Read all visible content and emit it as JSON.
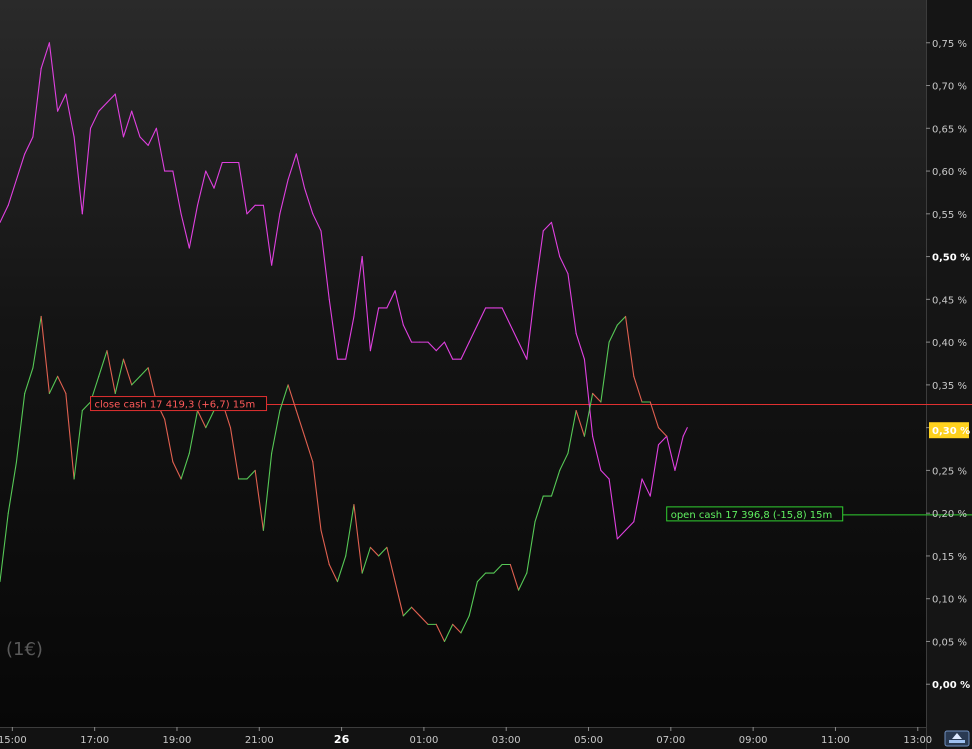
{
  "watermark": "(1€)",
  "chart_data": {
    "type": "line",
    "y_unit": "%",
    "ylim": [
      -0.05,
      0.8
    ],
    "y_ticks": [
      "0,75 %",
      "0,70 %",
      "0,65 %",
      "0,60 %",
      "0,55 %",
      "0,50 %",
      "0,45 %",
      "0,40 %",
      "0,35 %",
      "0,30 %",
      "0,25 %",
      "0,20 %",
      "0,15 %",
      "0,10 %",
      "0,05 %",
      "0,00 %"
    ],
    "y_tick_values": [
      0.75,
      0.7,
      0.65,
      0.6,
      0.55,
      0.5,
      0.45,
      0.4,
      0.35,
      0.3,
      0.25,
      0.2,
      0.15,
      0.1,
      0.05,
      0.0
    ],
    "bold_ticks": [
      "0,50 %",
      "0,00 %"
    ],
    "x_ticks": [
      {
        "label": "15:00",
        "t": 0
      },
      {
        "label": "17:00",
        "t": 2
      },
      {
        "label": "19:00",
        "t": 4
      },
      {
        "label": "21:00",
        "t": 6
      },
      {
        "label": "26",
        "t": 8,
        "bold": true
      },
      {
        "label": "01:00",
        "t": 10
      },
      {
        "label": "03:00",
        "t": 12
      },
      {
        "label": "05:00",
        "t": 14
      },
      {
        "label": "07:00",
        "t": 16
      },
      {
        "label": "09:00",
        "t": 18
      },
      {
        "label": "11:00",
        "t": 20
      },
      {
        "label": "13:00",
        "t": 22
      }
    ],
    "xlim": [
      -0.3,
      22.2
    ],
    "series": [
      {
        "color": "#e040e0",
        "points": [
          [
            -0.3,
            0.54
          ],
          [
            -0.1,
            0.56
          ],
          [
            0.1,
            0.59
          ],
          [
            0.3,
            0.62
          ],
          [
            0.5,
            0.64
          ],
          [
            0.7,
            0.72
          ],
          [
            0.9,
            0.75
          ],
          [
            1.1,
            0.67
          ],
          [
            1.3,
            0.69
          ],
          [
            1.5,
            0.64
          ],
          [
            1.7,
            0.55
          ],
          [
            1.9,
            0.65
          ],
          [
            2.1,
            0.67
          ],
          [
            2.3,
            0.68
          ],
          [
            2.5,
            0.69
          ],
          [
            2.7,
            0.64
          ],
          [
            2.9,
            0.67
          ],
          [
            3.1,
            0.64
          ],
          [
            3.3,
            0.63
          ],
          [
            3.5,
            0.65
          ],
          [
            3.7,
            0.6
          ],
          [
            3.9,
            0.6
          ],
          [
            4.1,
            0.55
          ],
          [
            4.3,
            0.51
          ],
          [
            4.5,
            0.56
          ],
          [
            4.7,
            0.6
          ],
          [
            4.9,
            0.58
          ],
          [
            5.1,
            0.61
          ],
          [
            5.3,
            0.61
          ],
          [
            5.5,
            0.61
          ],
          [
            5.7,
            0.55
          ],
          [
            5.9,
            0.56
          ],
          [
            6.1,
            0.56
          ],
          [
            6.3,
            0.49
          ],
          [
            6.5,
            0.55
          ],
          [
            6.7,
            0.59
          ],
          [
            6.9,
            0.62
          ],
          [
            7.1,
            0.58
          ],
          [
            7.3,
            0.55
          ],
          [
            7.5,
            0.53
          ],
          [
            7.7,
            0.45
          ],
          [
            7.9,
            0.38
          ],
          [
            8.1,
            0.38
          ],
          [
            8.3,
            0.43
          ],
          [
            8.5,
            0.5
          ],
          [
            8.7,
            0.39
          ],
          [
            8.9,
            0.44
          ],
          [
            9.1,
            0.44
          ],
          [
            9.3,
            0.46
          ],
          [
            9.5,
            0.42
          ],
          [
            9.7,
            0.4
          ],
          [
            9.9,
            0.4
          ],
          [
            10.1,
            0.4
          ],
          [
            10.3,
            0.39
          ],
          [
            10.5,
            0.4
          ],
          [
            10.7,
            0.38
          ],
          [
            10.9,
            0.38
          ],
          [
            11.1,
            0.4
          ],
          [
            11.3,
            0.42
          ],
          [
            11.5,
            0.44
          ],
          [
            11.7,
            0.44
          ],
          [
            11.9,
            0.44
          ],
          [
            12.1,
            0.42
          ],
          [
            12.3,
            0.4
          ],
          [
            12.5,
            0.38
          ],
          [
            12.7,
            0.46
          ],
          [
            12.9,
            0.53
          ],
          [
            13.1,
            0.54
          ],
          [
            13.3,
            0.5
          ],
          [
            13.5,
            0.48
          ],
          [
            13.7,
            0.41
          ],
          [
            13.9,
            0.38
          ],
          [
            14.1,
            0.29
          ],
          [
            14.3,
            0.25
          ],
          [
            14.5,
            0.24
          ],
          [
            14.7,
            0.17
          ],
          [
            14.9,
            0.18
          ],
          [
            15.1,
            0.19
          ],
          [
            15.3,
            0.24
          ],
          [
            15.5,
            0.22
          ],
          [
            15.7,
            0.28
          ],
          [
            15.9,
            0.29
          ],
          [
            16.1,
            0.25
          ],
          [
            16.3,
            0.29
          ],
          [
            16.4,
            0.3
          ]
        ]
      },
      {
        "color": "#56c856",
        "down_color": "#e06050",
        "points": [
          [
            -0.3,
            0.12
          ],
          [
            -0.1,
            0.2
          ],
          [
            0.1,
            0.26
          ],
          [
            0.3,
            0.34
          ],
          [
            0.5,
            0.37
          ],
          [
            0.7,
            0.43
          ],
          [
            0.9,
            0.34
          ],
          [
            1.1,
            0.36
          ],
          [
            1.3,
            0.34
          ],
          [
            1.5,
            0.24
          ],
          [
            1.7,
            0.32
          ],
          [
            1.9,
            0.33
          ],
          [
            2.1,
            0.36
          ],
          [
            2.3,
            0.39
          ],
          [
            2.5,
            0.34
          ],
          [
            2.7,
            0.38
          ],
          [
            2.9,
            0.35
          ],
          [
            3.1,
            0.36
          ],
          [
            3.3,
            0.37
          ],
          [
            3.5,
            0.33
          ],
          [
            3.7,
            0.31
          ],
          [
            3.9,
            0.26
          ],
          [
            4.1,
            0.24
          ],
          [
            4.3,
            0.27
          ],
          [
            4.5,
            0.32
          ],
          [
            4.7,
            0.3
          ],
          [
            4.9,
            0.32
          ],
          [
            5.1,
            0.33
          ],
          [
            5.3,
            0.3
          ],
          [
            5.5,
            0.24
          ],
          [
            5.7,
            0.24
          ],
          [
            5.9,
            0.25
          ],
          [
            6.1,
            0.18
          ],
          [
            6.3,
            0.27
          ],
          [
            6.5,
            0.32
          ],
          [
            6.7,
            0.35
          ],
          [
            6.9,
            0.32
          ],
          [
            7.1,
            0.29
          ],
          [
            7.3,
            0.26
          ],
          [
            7.5,
            0.18
          ],
          [
            7.7,
            0.14
          ],
          [
            7.9,
            0.12
          ],
          [
            8.1,
            0.15
          ],
          [
            8.3,
            0.21
          ],
          [
            8.5,
            0.13
          ],
          [
            8.7,
            0.16
          ],
          [
            8.9,
            0.15
          ],
          [
            9.1,
            0.16
          ],
          [
            9.3,
            0.12
          ],
          [
            9.5,
            0.08
          ],
          [
            9.7,
            0.09
          ],
          [
            9.9,
            0.08
          ],
          [
            10.1,
            0.07
          ],
          [
            10.3,
            0.07
          ],
          [
            10.5,
            0.05
          ],
          [
            10.7,
            0.07
          ],
          [
            10.9,
            0.06
          ],
          [
            11.1,
            0.08
          ],
          [
            11.3,
            0.12
          ],
          [
            11.5,
            0.13
          ],
          [
            11.7,
            0.13
          ],
          [
            11.9,
            0.14
          ],
          [
            12.1,
            0.14
          ],
          [
            12.3,
            0.11
          ],
          [
            12.5,
            0.13
          ],
          [
            12.7,
            0.19
          ],
          [
            12.9,
            0.22
          ],
          [
            13.1,
            0.22
          ],
          [
            13.3,
            0.25
          ],
          [
            13.5,
            0.27
          ],
          [
            13.7,
            0.32
          ],
          [
            13.9,
            0.29
          ],
          [
            14.1,
            0.34
          ],
          [
            14.3,
            0.33
          ],
          [
            14.5,
            0.4
          ],
          [
            14.7,
            0.42
          ],
          [
            14.9,
            0.43
          ],
          [
            15.1,
            0.36
          ],
          [
            15.3,
            0.33
          ],
          [
            15.5,
            0.33
          ],
          [
            15.7,
            0.3
          ],
          [
            15.9,
            0.29
          ]
        ]
      }
    ],
    "reference_lines": [
      {
        "label": "close cash 17 419,3 (+6,7) 15m",
        "y": 0.327,
        "color": "#e03030",
        "text_color": "#ff5a5a",
        "label_at_t": 1.9
      },
      {
        "label": "open cash 17 396,8 (-15,8) 15m",
        "y": 0.198,
        "color": "#30d030",
        "text_color": "#60f060",
        "label_at_t": 15.9
      }
    ],
    "last_value_badge": {
      "label": "0,30 %",
      "y": 0.297,
      "bg": "#ffd21e",
      "fg": "#000000"
    }
  }
}
